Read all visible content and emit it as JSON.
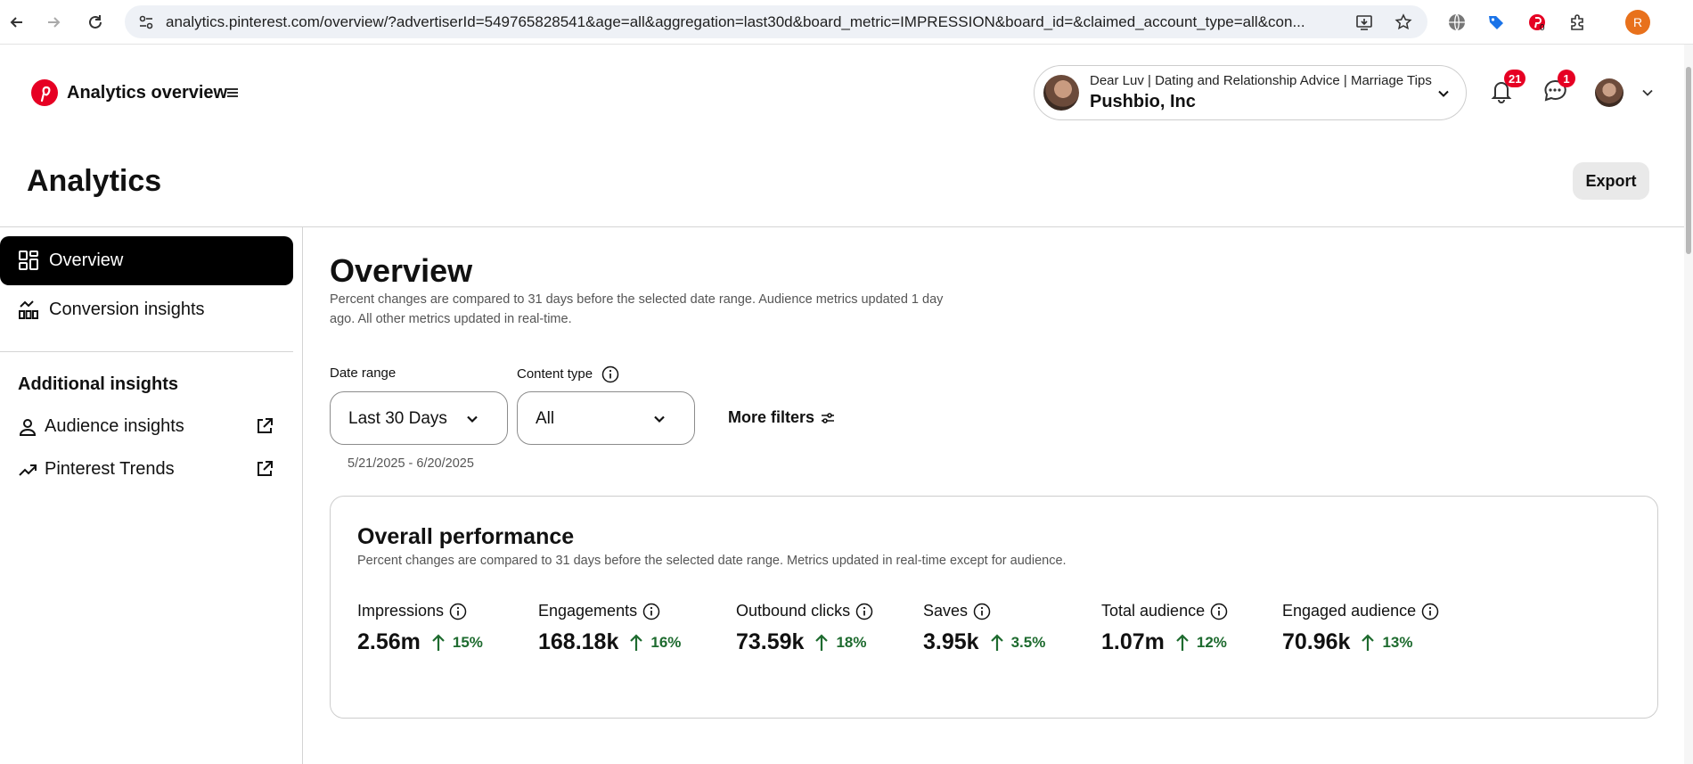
{
  "browser": {
    "url": "analytics.pinterest.com/overview/?advertiserId=549765828541&age=all&aggregation=last30d&board_metric=IMPRESSION&board_id=&claimed_account_type=all&con...",
    "profile_initial": "R",
    "extension_badge": "0"
  },
  "app": {
    "title": "Analytics overview",
    "account": {
      "name": "Dear Luv | Dating and Relationship Advice | Marriage Tips",
      "business": "Pushbio, Inc"
    },
    "notifications_count": "21",
    "messages_count": "1"
  },
  "page": {
    "title": "Analytics",
    "export_label": "Export"
  },
  "sidebar": {
    "items": [
      {
        "label": "Overview",
        "icon": "grid-icon",
        "active": true
      },
      {
        "label": "Conversion insights",
        "icon": "conversion-chart-icon",
        "active": false
      }
    ],
    "additional_heading": "Additional insights",
    "links": [
      {
        "label": "Audience insights",
        "icon": "person-icon"
      },
      {
        "label": "Pinterest Trends",
        "icon": "trend-icon"
      }
    ]
  },
  "main": {
    "title": "Overview",
    "subtitle": "Percent changes are compared to 31 days before the selected date range. Audience metrics updated 1 day ago. All other metrics updated in real-time.",
    "filters": {
      "date_range_label": "Date range",
      "date_range_value": "Last 30 Days",
      "content_type_label": "Content type",
      "content_type_value": "All",
      "more_filters_label": "More filters",
      "date_hint": "5/21/2025 - 6/20/2025"
    },
    "performance": {
      "title": "Overall performance",
      "subtitle": "Percent changes are compared to 31 days before the selected date range. Metrics updated in real-time except for audience.",
      "metrics": [
        {
          "label": "Impressions",
          "value": "2.56m",
          "change": "15%"
        },
        {
          "label": "Engagements",
          "value": "168.18k",
          "change": "16%"
        },
        {
          "label": "Outbound clicks",
          "value": "73.59k",
          "change": "18%"
        },
        {
          "label": "Saves",
          "value": "3.95k",
          "change": "3.5%"
        },
        {
          "label": "Total audience",
          "value": "1.07m",
          "change": "12%"
        },
        {
          "label": "Engaged audience",
          "value": "70.96k",
          "change": "13%"
        }
      ]
    }
  },
  "colors": {
    "brand": "#e60023",
    "positive": "#1e6b2f",
    "active_nav": "#000000"
  }
}
